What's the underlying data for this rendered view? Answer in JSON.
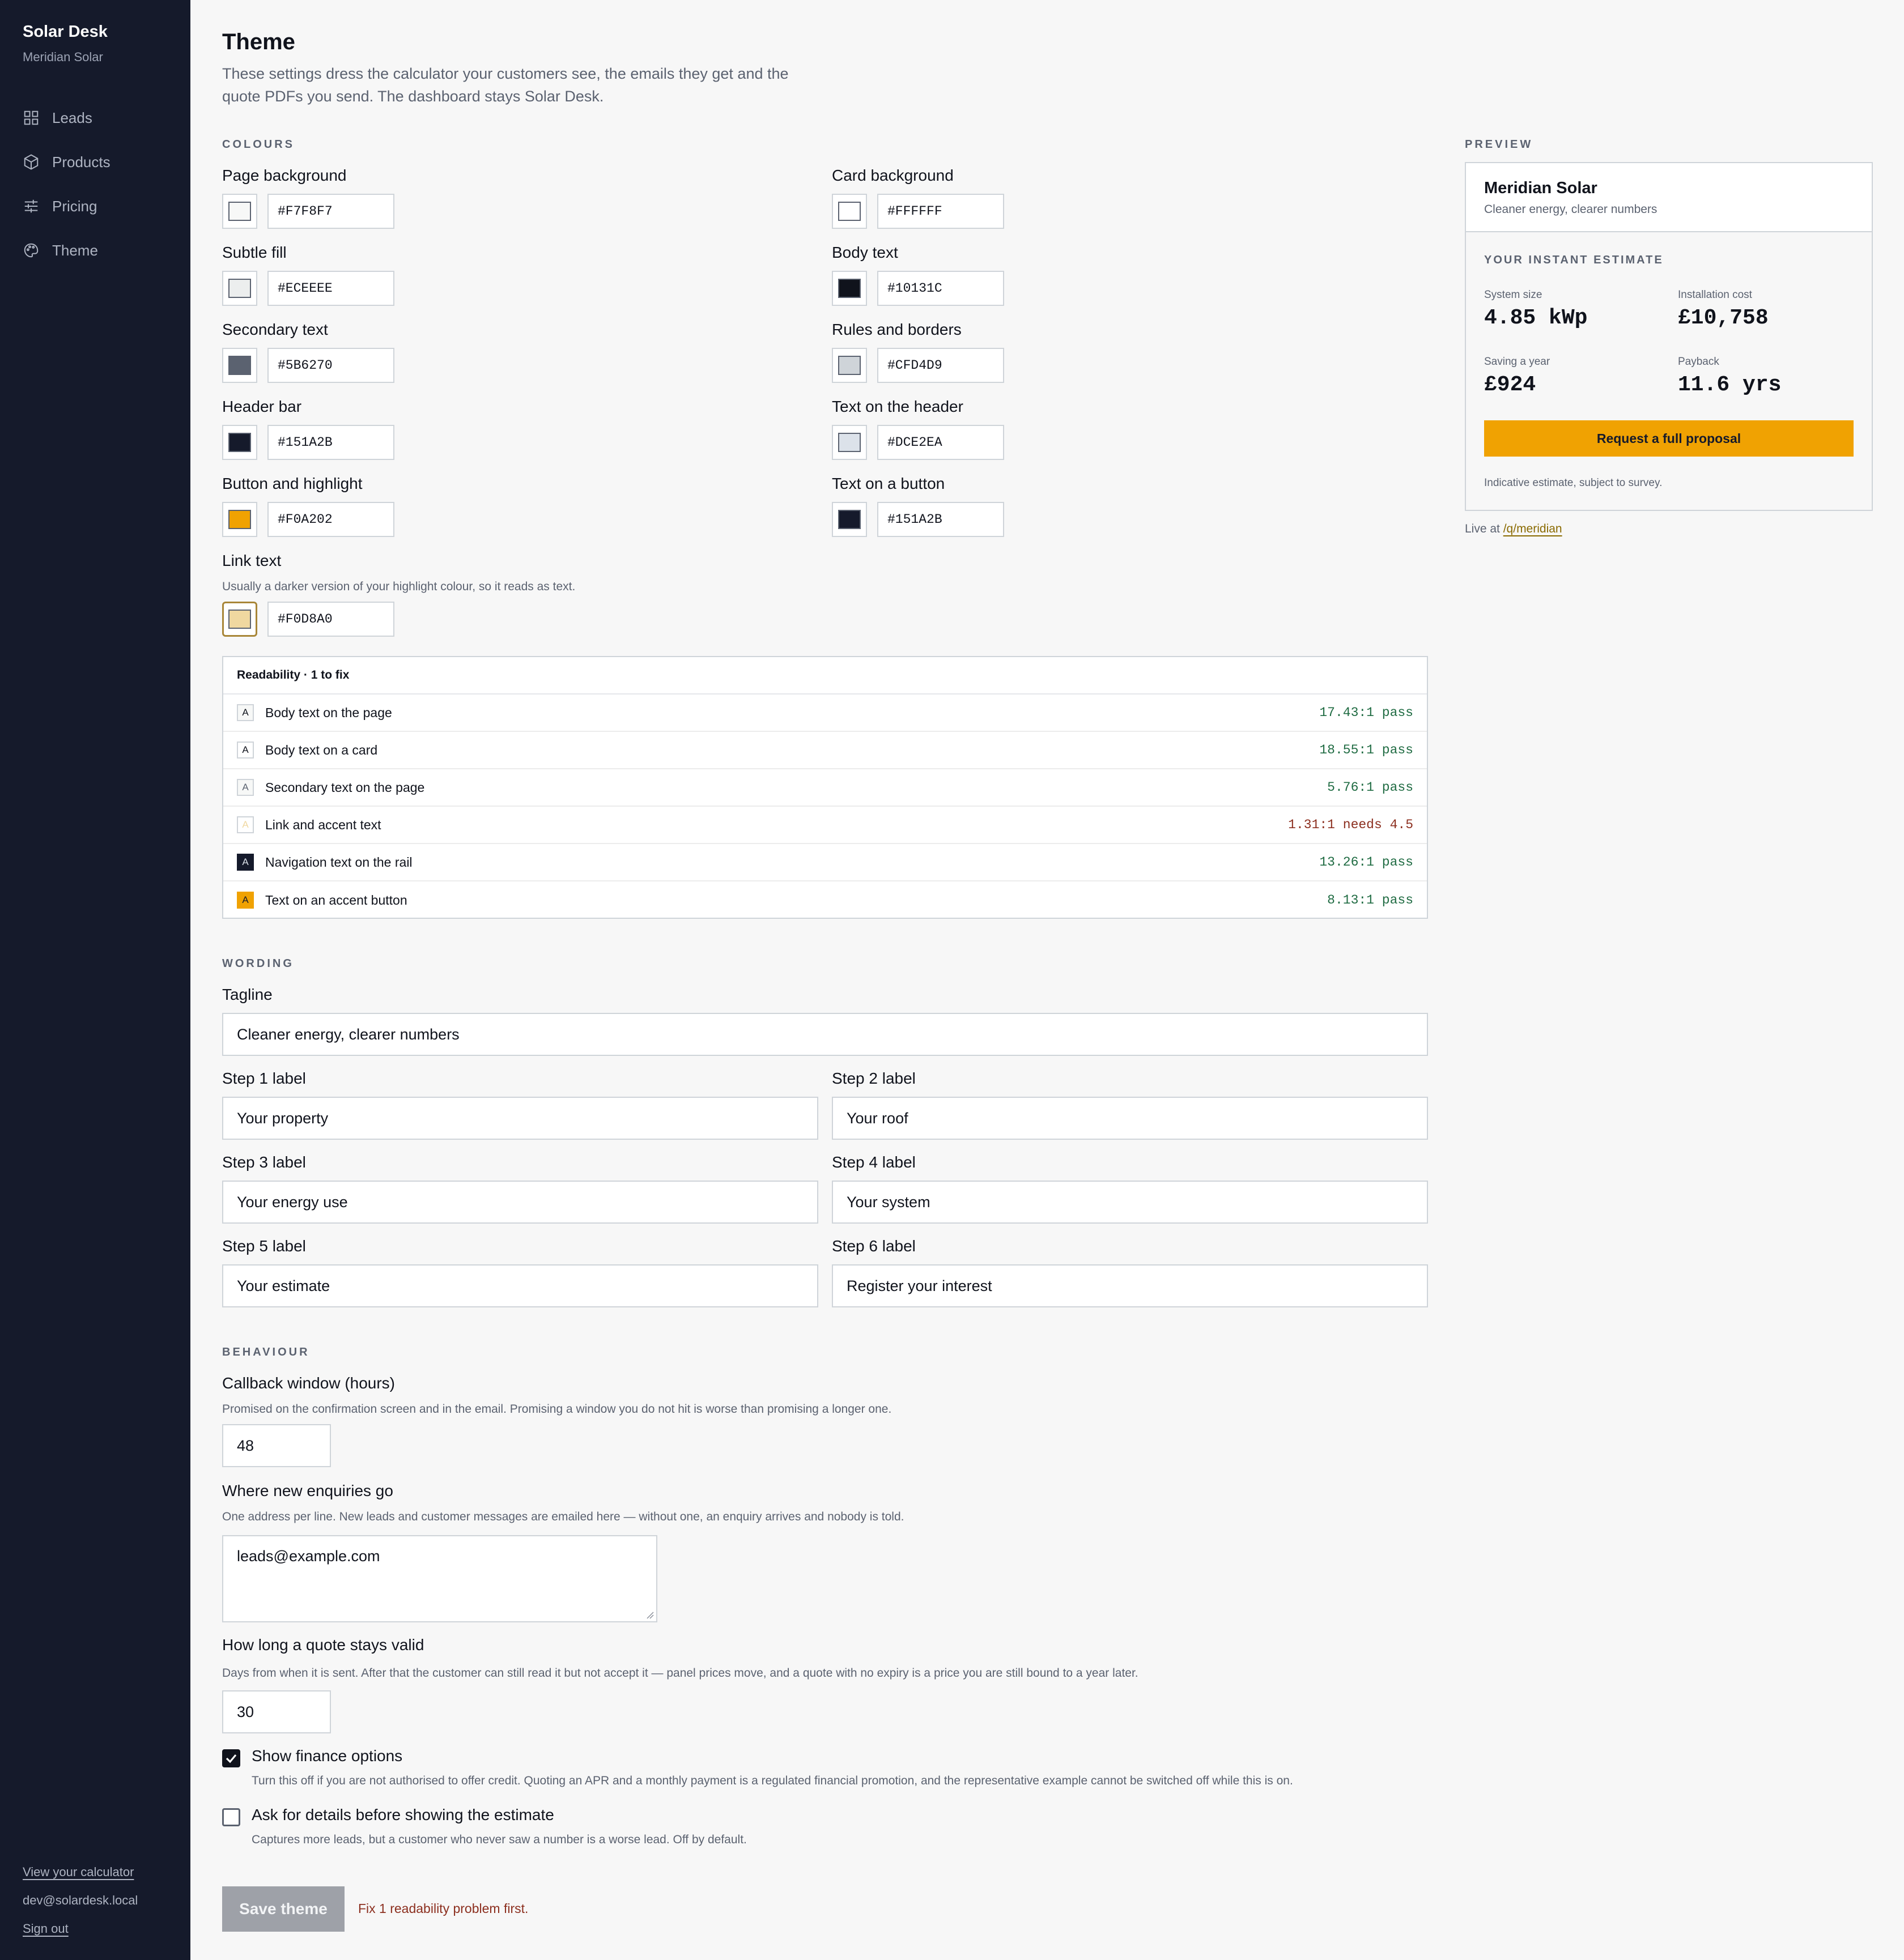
{
  "sidebar": {
    "brand": "Solar Desk",
    "org": "Meridian Solar",
    "nav": [
      {
        "label": "Leads",
        "icon": "grid-icon"
      },
      {
        "label": "Products",
        "icon": "box-icon"
      },
      {
        "label": "Pricing",
        "icon": "sliders-icon"
      },
      {
        "label": "Theme",
        "icon": "palette-icon"
      }
    ],
    "view_calculator": "View your calculator",
    "email": "dev@solardesk.local",
    "sign_out": "Sign out"
  },
  "header": {
    "title": "Theme",
    "intro": "These settings dress the calculator your customers see, the emails they get and the quote PDFs you send. The dashboard stays Solar Desk."
  },
  "colours": {
    "section_label": "COLOURS",
    "fields": [
      {
        "label": "Page background",
        "hex": "#F7F8F7"
      },
      {
        "label": "Card background",
        "hex": "#FFFFFF"
      },
      {
        "label": "Subtle fill",
        "hex": "#ECEEEE"
      },
      {
        "label": "Body text",
        "hex": "#10131C"
      },
      {
        "label": "Secondary text",
        "hex": "#5B6270"
      },
      {
        "label": "Rules and borders",
        "hex": "#CFD4D9"
      },
      {
        "label": "Header bar",
        "hex": "#151A2B"
      },
      {
        "label": "Text on the header",
        "hex": "#DCE2EA"
      },
      {
        "label": "Button and highlight",
        "hex": "#F0A202"
      },
      {
        "label": "Text on a button",
        "hex": "#151A2B"
      }
    ],
    "link": {
      "label": "Link text",
      "help": "Usually a darker version of your highlight colour, so it reads as text.",
      "hex": "#F0D8A0"
    }
  },
  "readability": {
    "title": "Readability · 1 to fix",
    "rows": [
      {
        "label": "Body text on the page",
        "ratio": "17.43:1 pass",
        "status": "pass",
        "tile_bg": "#F7F8F7",
        "tile_fg": "#10131C"
      },
      {
        "label": "Body text on a card",
        "ratio": "18.55:1 pass",
        "status": "pass",
        "tile_bg": "#FFFFFF",
        "tile_fg": "#10131C"
      },
      {
        "label": "Secondary text on the page",
        "ratio": "5.76:1 pass",
        "status": "pass",
        "tile_bg": "#F7F8F7",
        "tile_fg": "#5B6270"
      },
      {
        "label": "Link and accent text",
        "ratio": "1.31:1 needs 4.5",
        "status": "fail",
        "tile_bg": "#FFFFFF",
        "tile_fg": "#F0D8A0"
      },
      {
        "label": "Navigation text on the rail",
        "ratio": "13.26:1 pass",
        "status": "pass",
        "tile_bg": "#151A2B",
        "tile_fg": "#DCE2EA"
      },
      {
        "label": "Text on an accent button",
        "ratio": "8.13:1 pass",
        "status": "pass",
        "tile_bg": "#F0A202",
        "tile_fg": "#151A2B"
      }
    ],
    "tile_letter": "A"
  },
  "wording": {
    "section_label": "WORDING",
    "tagline": {
      "label": "Tagline",
      "value": "Cleaner energy, clearer numbers"
    },
    "steps": [
      {
        "label": "Step 1 label",
        "value": "Your property"
      },
      {
        "label": "Step 2 label",
        "value": "Your roof"
      },
      {
        "label": "Step 3 label",
        "value": "Your energy use"
      },
      {
        "label": "Step 4 label",
        "value": "Your system"
      },
      {
        "label": "Step 5 label",
        "value": "Your estimate"
      },
      {
        "label": "Step 6 label",
        "value": "Register your interest"
      }
    ]
  },
  "behaviour": {
    "section_label": "BEHAVIOUR",
    "callback": {
      "label": "Callback window (hours)",
      "help": "Promised on the confirmation screen and in the email. Promising a window you do not hit is worse than promising a longer one.",
      "value": "48"
    },
    "enquiries": {
      "label": "Where new enquiries go",
      "help": "One address per line. New leads and customer messages are emailed here — without one, an enquiry arrives and nobody is told.",
      "value": "leads@example.com"
    },
    "validity": {
      "label": "How long a quote stays valid",
      "help": "Days from when it is sent. After that the customer can still read it but not accept it — panel prices move, and a quote with no expiry is a price you are still bound to a year later.",
      "value": "30"
    },
    "finance": {
      "label": "Show finance options",
      "help": "Turn this off if you are not authorised to offer credit. Quoting an APR and a monthly payment is a regulated financial promotion, and the representative example cannot be switched off while this is on.",
      "checked": true
    },
    "ask_details": {
      "label": "Ask for details before showing the estimate",
      "help": "Captures more leads, but a customer who never saw a number is a worse lead. Off by default.",
      "checked": false
    }
  },
  "save": {
    "label": "Save theme",
    "message": "Fix 1 readability problem first."
  },
  "preview": {
    "section_label": "PREVIEW",
    "company": "Meridian Solar",
    "tagline": "Cleaner energy, clearer numbers",
    "estimate_label": "YOUR INSTANT ESTIMATE",
    "stats": [
      {
        "label": "System size",
        "value": "4.85 kWp"
      },
      {
        "label": "Installation cost",
        "value": "£10,758"
      },
      {
        "label": "Saving a year",
        "value": "£924"
      },
      {
        "label": "Payback",
        "value": "11.6 yrs"
      }
    ],
    "button": "Request a full proposal",
    "note": "Indicative estimate, subject to survey.",
    "live_prefix": "Live at",
    "live_link": "/q/meridian"
  }
}
